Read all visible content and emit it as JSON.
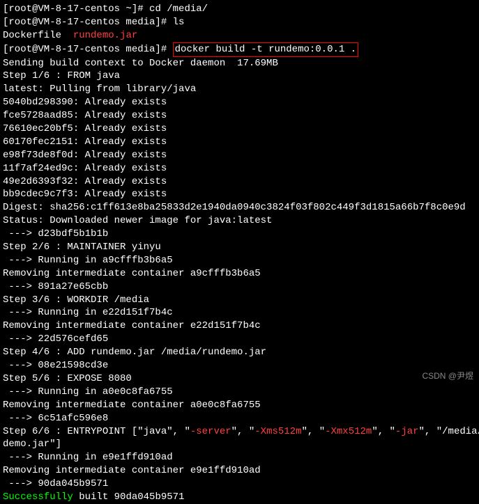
{
  "prompt1_prefix": "[root@VM-8-17-centos ~]# ",
  "cmd1": "cd /media/",
  "prompt2_prefix": "[root@VM-8-17-centos media]# ",
  "cmd2": "ls",
  "ls_file1": "Dockerfile",
  "ls_file2": "rundemo.jar",
  "prompt3_prefix": "[root@VM-8-17-centos media]# ",
  "cmd3": "docker build -t rundemo:0.0.1 .",
  "build": {
    "context": "Sending build context to Docker daemon  17.69MB",
    "step1": "Step 1/6 : FROM java",
    "pulling": "latest: Pulling from library/java",
    "layers": [
      "5040bd298390: Already exists",
      "fce5728aad85: Already exists",
      "76610ec20bf5: Already exists",
      "60170fec2151: Already exists",
      "e98f73de8f0d: Already exists",
      "11f7af24ed9c: Already exists",
      "49e2d6393f32: Already exists",
      "bb9cdec9c7f3: Already exists"
    ],
    "digest": "Digest: sha256:c1ff613e8ba25833d2e1940da0940c3824f03f802c449f3d1815a66b7f8c0e9d",
    "status": "Status: Downloaded newer image for java:latest",
    "arrow1": " ---> d23bdf5b1b1b",
    "step2": "Step 2/6 : MAINTAINER yinyu",
    "run2": " ---> Running in a9cfffb3b6a5",
    "rm2": "Removing intermediate container a9cfffb3b6a5",
    "arrow2": " ---> 891a27e65cbb",
    "step3": "Step 3/6 : WORKDIR /media",
    "run3": " ---> Running in e22d151f7b4c",
    "rm3": "Removing intermediate container e22d151f7b4c",
    "arrow3": " ---> 22d576cefd65",
    "step4": "Step 4/6 : ADD rundemo.jar /media/rundemo.jar",
    "arrow4": " ---> 08e21598cd3e",
    "step5": "Step 5/6 : EXPOSE 8080",
    "run5": " ---> Running in a0e0c8fa6755",
    "rm5": "Removing intermediate container a0e0c8fa6755",
    "arrow5": " ---> 6c51afc596e8",
    "step6_p1": "Step 6/6 : ENTRYPOINT [\"java\", \"",
    "step6_server": "-server",
    "step6_sep": "\", \"",
    "step6_xms": "-Xms512m",
    "step6_xmx": "-Xmx512m",
    "step6_jar": "-jar",
    "step6_p2": "\", \"/media/run",
    "step6_line2": "demo.jar\"]",
    "run6": " ---> Running in e9e1ffd910ad",
    "rm6": "Removing intermediate container e9e1ffd910ad",
    "arrow6": " ---> 90da045b9571",
    "success_word": "Successfully",
    "success_rest": " built 90da045b9571"
  },
  "watermark": "CSDN @尹煜"
}
